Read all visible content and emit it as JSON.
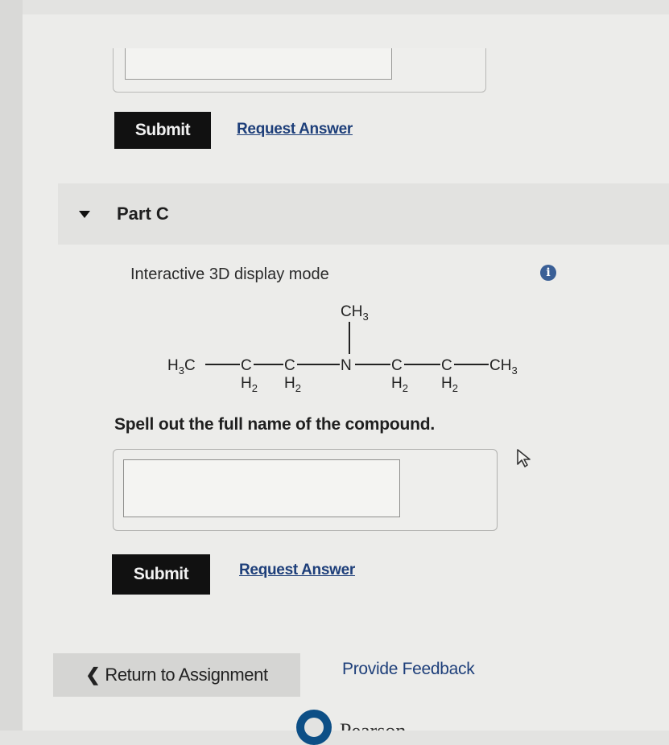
{
  "previous_part": {
    "submit_label": "Submit",
    "request_answer_label": "Request Answer"
  },
  "part_c": {
    "title": "Part C",
    "display_mode": "Interactive 3D display mode",
    "molecule": {
      "top_group": "CH",
      "top_sub": "3",
      "left_end": "H",
      "left_end_sub": "3",
      "left_end_c": "C",
      "carbon": "C",
      "nitrogen": "N",
      "right_end": "CH",
      "right_end_sub": "3",
      "h2": "H",
      "h2_sub": "2"
    },
    "prompt": "Spell out the full name of the compound.",
    "answer_value": "",
    "submit_label": "Submit",
    "request_answer_label": "Request Answer"
  },
  "footer": {
    "return_label": "Return to Assignment",
    "feedback_label": "Provide Feedback",
    "logo_text": "Pearson"
  },
  "colors": {
    "link": "#1e3f7a",
    "button": "#111111",
    "info": "#3a5f96"
  }
}
